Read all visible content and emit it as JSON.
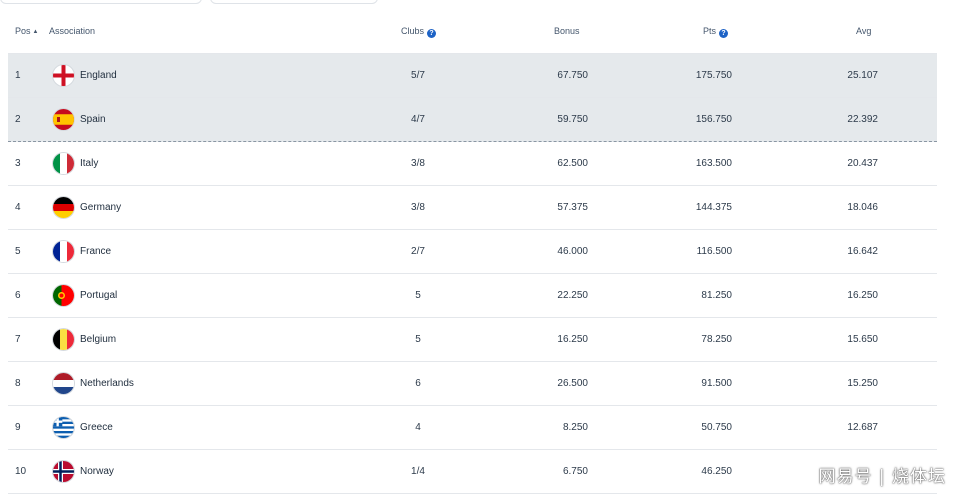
{
  "header": {
    "pos": "Pos",
    "association": "Association",
    "clubs": "Clubs",
    "bonus": "Bonus",
    "pts": "Pts",
    "avg": "Avg",
    "help_glyph": "?",
    "sort_glyph": "▲"
  },
  "rows": [
    {
      "pos": "1",
      "name": "England",
      "clubs": "5/7",
      "bonus": "67.750",
      "pts": "175.750",
      "avg": "25.107",
      "flag": "england-flag-icon"
    },
    {
      "pos": "2",
      "name": "Spain",
      "clubs": "4/7",
      "bonus": "59.750",
      "pts": "156.750",
      "avg": "22.392",
      "flag": "spain-flag-icon"
    },
    {
      "pos": "3",
      "name": "Italy",
      "clubs": "3/8",
      "bonus": "62.500",
      "pts": "163.500",
      "avg": "20.437",
      "flag": "italy-flag-icon"
    },
    {
      "pos": "4",
      "name": "Germany",
      "clubs": "3/8",
      "bonus": "57.375",
      "pts": "144.375",
      "avg": "18.046",
      "flag": "germany-flag-icon"
    },
    {
      "pos": "5",
      "name": "France",
      "clubs": "2/7",
      "bonus": "46.000",
      "pts": "116.500",
      "avg": "16.642",
      "flag": "france-flag-icon"
    },
    {
      "pos": "6",
      "name": "Portugal",
      "clubs": "5",
      "bonus": "22.250",
      "pts": "81.250",
      "avg": "16.250",
      "flag": "portugal-flag-icon"
    },
    {
      "pos": "7",
      "name": "Belgium",
      "clubs": "5",
      "bonus": "16.250",
      "pts": "78.250",
      "avg": "15.650",
      "flag": "belgium-flag-icon"
    },
    {
      "pos": "8",
      "name": "Netherlands",
      "clubs": "6",
      "bonus": "26.500",
      "pts": "91.500",
      "avg": "15.250",
      "flag": "netherlands-flag-icon"
    },
    {
      "pos": "9",
      "name": "Greece",
      "clubs": "4",
      "bonus": "8.250",
      "pts": "50.750",
      "avg": "12.687",
      "flag": "greece-flag-icon"
    },
    {
      "pos": "10",
      "name": "Norway",
      "clubs": "1/4",
      "bonus": "6.750",
      "pts": "46.250",
      "avg": "",
      "flag": "norway-flag-icon"
    }
  ],
  "watermark": "网易号 | 烧体坛"
}
